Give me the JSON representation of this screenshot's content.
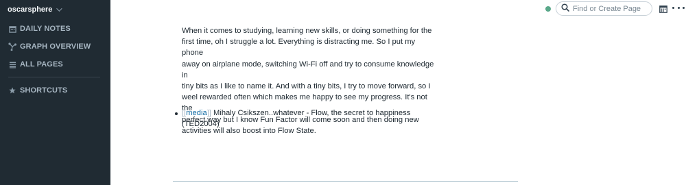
{
  "sidebar": {
    "workspace": "oscarsphere",
    "items": [
      {
        "label": "DAILY NOTES"
      },
      {
        "label": "GRAPH OVERVIEW"
      },
      {
        "label": "ALL PAGES"
      },
      {
        "label": "SHORTCUTS"
      }
    ]
  },
  "topbar": {
    "search_placeholder": "Find or Create Page",
    "status_color": "#5aa88a"
  },
  "page": {
    "paragraph": "When it comes to studying, learning new skills, or doing something for the\nfirst time, oh I struggle a lot. Everything is distracting me. So I put my phone\naway on airplane mode, switching Wi-Fi off and try to consume knowledge in\ntiny bits as I like to name it. And with a tiny bits, I try to move forward, so I\nweel rewarded often which makes me happy to see my progress. It's not the\nperfect way but I know Fun Factor will come soon and then doing new\nactivities will also boost into Flow State.",
    "bullet": {
      "open_bracket": "[[",
      "ref": "media",
      "close_bracket": "]]",
      "text": " Mihaly Csikszen..whatever - Flow, the secret to happiness\n(TED2004)"
    }
  }
}
